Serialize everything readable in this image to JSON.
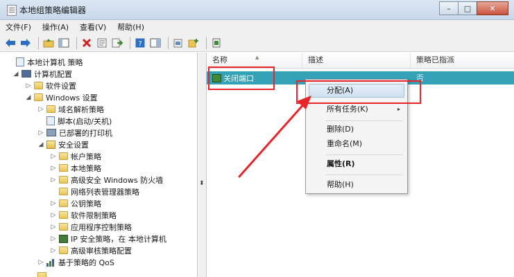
{
  "window": {
    "title": "本地组策略编辑器",
    "controls": {
      "minimize": "–",
      "maximize": "□",
      "close": "✕"
    }
  },
  "menu": [
    "文件(F)",
    "操作(A)",
    "查看(V)",
    "帮助(H)"
  ],
  "toolbar": {
    "icons": [
      "back-arrow-icon",
      "forward-arrow-icon",
      "up-folder-icon",
      "show-tree-icon",
      "delete-icon",
      "properties-icon",
      "export-icon",
      "help-icon",
      "show-pane-icon",
      "manage-ip-filter-icon",
      "add-policy-icon",
      "ip-policy-icon"
    ],
    "accent_red": "#d22020",
    "accent_blue": "#2b6cc4"
  },
  "tree": [
    {
      "label": "本地计算机 策略",
      "depth": 0,
      "arrow": "",
      "icon": "policy"
    },
    {
      "label": "计算机配置",
      "depth": 1,
      "arrow": "◢",
      "icon": "computer"
    },
    {
      "label": "软件设置",
      "depth": 2,
      "arrow": "▷",
      "icon": "folder"
    },
    {
      "label": "Windows 设置",
      "depth": 2,
      "arrow": "◢",
      "icon": "folder"
    },
    {
      "label": "域名解析策略",
      "depth": 3,
      "arrow": "▷",
      "icon": "folder"
    },
    {
      "label": "脚本(启动/关机)",
      "depth": 3,
      "arrow": "",
      "icon": "script"
    },
    {
      "label": "已部署的打印机",
      "depth": 3,
      "arrow": "▷",
      "icon": "printer"
    },
    {
      "label": "安全设置",
      "depth": 3,
      "arrow": "◢",
      "icon": "security"
    },
    {
      "label": "帐户策略",
      "depth": 4,
      "arrow": "▷",
      "icon": "folder"
    },
    {
      "label": "本地策略",
      "depth": 4,
      "arrow": "▷",
      "icon": "folder"
    },
    {
      "label": "高级安全 Windows 防火墙",
      "depth": 4,
      "arrow": "▷",
      "icon": "folder"
    },
    {
      "label": "网络列表管理器策略",
      "depth": 4,
      "arrow": "",
      "icon": "folder"
    },
    {
      "label": "公钥策略",
      "depth": 4,
      "arrow": "▷",
      "icon": "folder"
    },
    {
      "label": "软件限制策略",
      "depth": 4,
      "arrow": "▷",
      "icon": "folder"
    },
    {
      "label": "应用程序控制策略",
      "depth": 4,
      "arrow": "▷",
      "icon": "folder"
    },
    {
      "label": "IP 安全策略，在 本地计算机",
      "depth": 4,
      "arrow": "▷",
      "icon": "ip"
    },
    {
      "label": "高级审核策略配置",
      "depth": 4,
      "arrow": "▷",
      "icon": "folder"
    },
    {
      "label": "基于策略的 QoS",
      "depth": 2,
      "arrow": "▷",
      "icon": "qos"
    }
  ],
  "list": {
    "columns": [
      "名称",
      "描述",
      "策略已指派"
    ],
    "rows": [
      {
        "name": "关闭端口",
        "description": "",
        "assigned": "否"
      }
    ],
    "selected_color": "#33a1b6"
  },
  "context_menu": {
    "items": [
      {
        "label": "分配(A)",
        "bold": false,
        "highlighted": true,
        "submenu": false
      },
      {
        "label": "所有任务(K)",
        "bold": false,
        "highlighted": false,
        "submenu": true
      },
      {
        "label": "删除(D)",
        "bold": false,
        "highlighted": false,
        "submenu": false
      },
      {
        "label": "重命名(M)",
        "bold": false,
        "highlighted": false,
        "submenu": false
      },
      {
        "label": "属性(R)",
        "bold": true,
        "highlighted": false,
        "submenu": false
      },
      {
        "label": "帮助(H)",
        "bold": false,
        "highlighted": false,
        "submenu": false
      }
    ],
    "submenu_glyph": "▸"
  },
  "annotations": {
    "color": "#e8232a"
  }
}
